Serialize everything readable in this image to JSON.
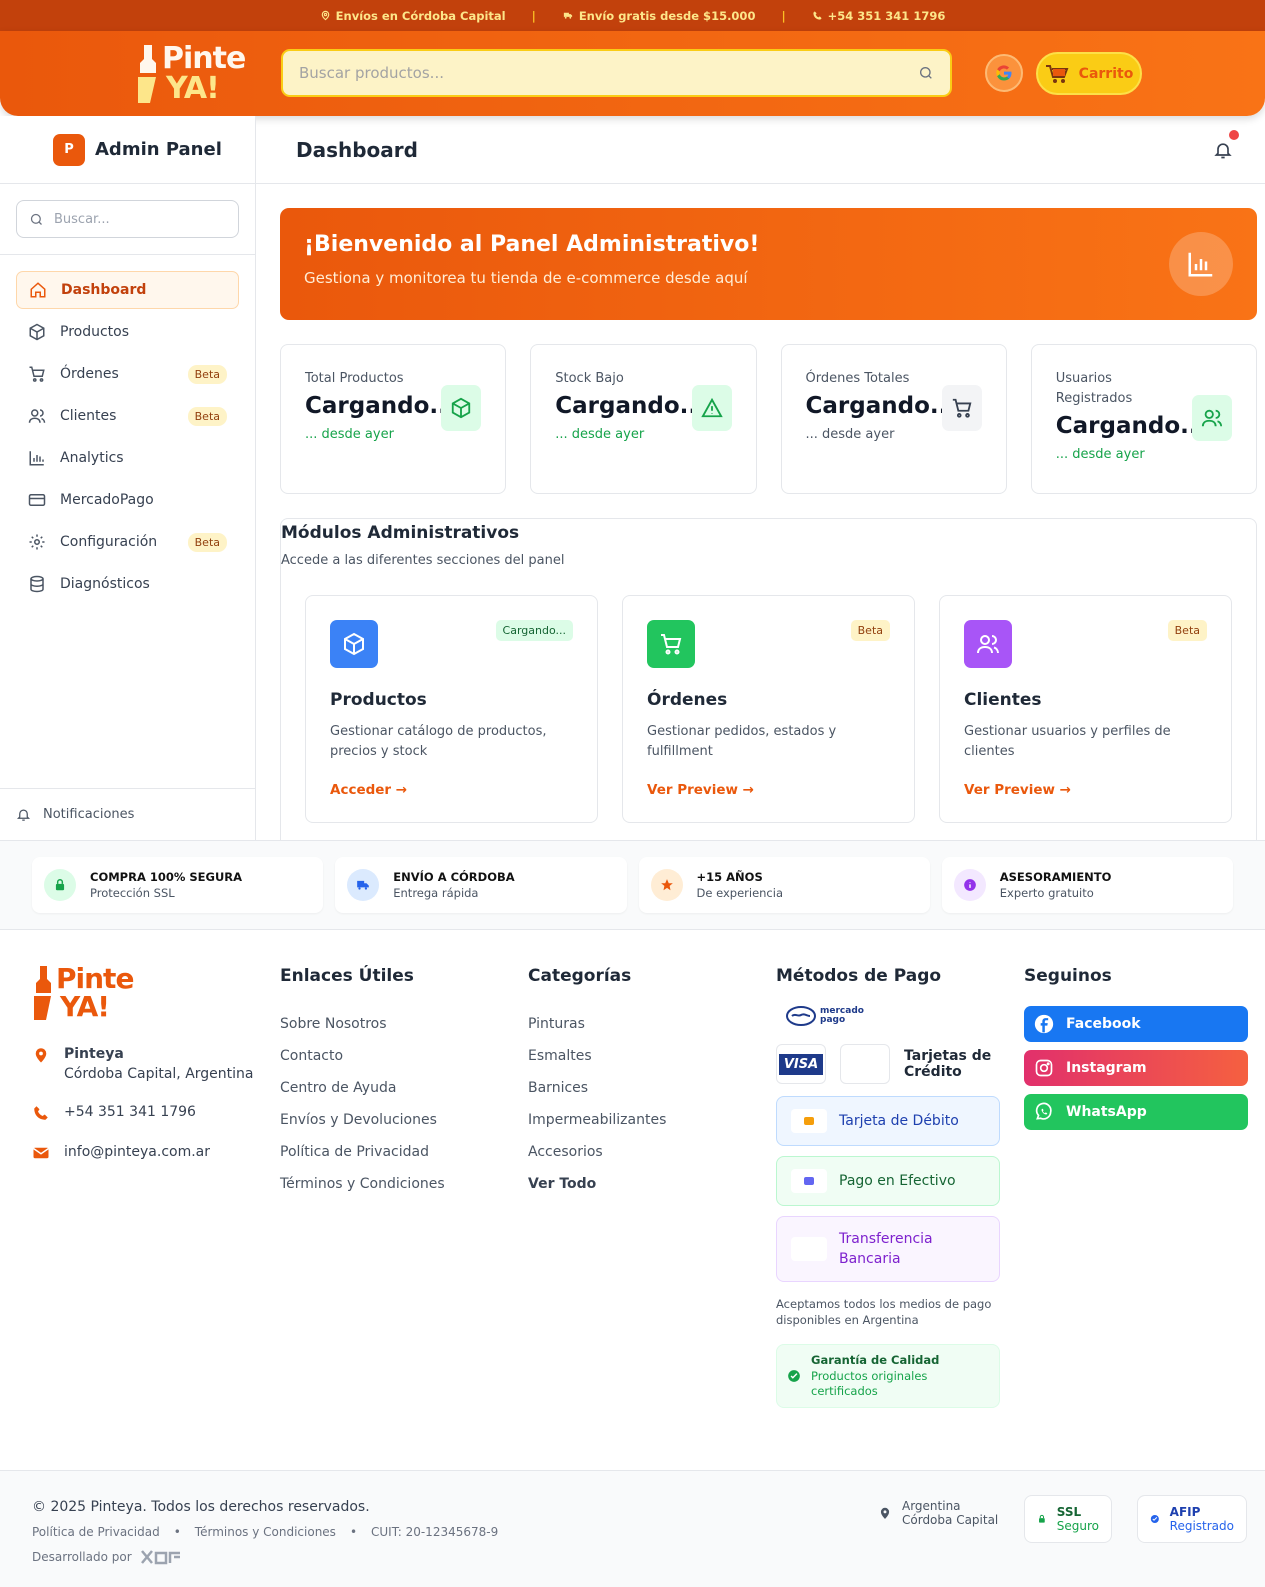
{
  "topbar": {
    "location": "Envíos en Córdoba Capital",
    "shipping": "Envío gratis desde $15.000",
    "phone": "+54 351 341 1796"
  },
  "header": {
    "search_placeholder": "Buscar productos...",
    "cart_label": "Carrito"
  },
  "sidebar": {
    "title": "Admin Panel",
    "logo_letter": "P",
    "search_placeholder": "Buscar...",
    "items": [
      {
        "label": "Dashboard",
        "icon": "home-icon"
      },
      {
        "label": "Productos",
        "icon": "box-icon"
      },
      {
        "label": "Órdenes",
        "icon": "cart-icon",
        "badge": "Beta"
      },
      {
        "label": "Clientes",
        "icon": "users-icon",
        "badge": "Beta"
      },
      {
        "label": "Analytics",
        "icon": "bar-chart-icon"
      },
      {
        "label": "MercadoPago",
        "icon": "credit-card-icon"
      },
      {
        "label": "Configuración",
        "icon": "gear-icon",
        "badge": "Beta"
      },
      {
        "label": "Diagnósticos",
        "icon": "database-icon"
      }
    ],
    "footer": "Notificaciones"
  },
  "main": {
    "title": "Dashboard",
    "welcome_title": "¡Bienvenido al Panel Administrativo!",
    "welcome_text": "Gestiona y monitorea tu tienda de e-commerce desde aquí",
    "stats": [
      {
        "label": "Total Productos",
        "value": "Cargando...",
        "sub": "... desde ayer"
      },
      {
        "label": "Stock Bajo",
        "value": "Cargando...",
        "sub": "... desde ayer"
      },
      {
        "label": "Órdenes Totales",
        "value": "Cargando...",
        "sub": "... desde ayer"
      },
      {
        "label": "Usuarios Registrados",
        "value": "Cargando...",
        "sub": "... desde ayer"
      }
    ],
    "modules_title": "Módulos Administrativos",
    "modules_desc": "Accede a las diferentes secciones del panel",
    "modules": [
      {
        "title": "Productos",
        "badge": "Cargando...",
        "desc": "Gestionar catálogo de productos, precios y stock",
        "link": "Acceder →"
      },
      {
        "title": "Órdenes",
        "badge": "Beta",
        "desc": "Gestionar pedidos, estados y fulfillment",
        "link": "Ver Preview →"
      },
      {
        "title": "Clientes",
        "badge": "Beta",
        "desc": "Gestionar usuarios y perfiles de clientes",
        "link": "Ver Preview →"
      }
    ]
  },
  "trust": [
    {
      "title": "COMPRA 100% SEGURA",
      "sub": "Protección SSL"
    },
    {
      "title": "ENVÍO A CÓRDOBA",
      "sub": "Entrega rápida"
    },
    {
      "title": "+15 AÑOS",
      "sub": "De experiencia"
    },
    {
      "title": "ASESORAMIENTO",
      "sub": "Experto gratuito"
    }
  ],
  "footer": {
    "company": "Pinteya",
    "address": "Córdoba Capital, Argentina",
    "phone": "+54 351 341 1796",
    "email": "info@pinteya.com.ar",
    "links_title": "Enlaces Útiles",
    "links": [
      "Sobre Nosotros",
      "Contacto",
      "Centro de Ayuda",
      "Envíos y Devoluciones",
      "Política de Privacidad",
      "Términos y Condiciones"
    ],
    "categories_title": "Categorías",
    "categories": [
      "Pinturas",
      "Esmaltes",
      "Barnices",
      "Impermeabilizantes",
      "Accesorios",
      "Ver Todo"
    ],
    "payments_title": "Métodos de Pago",
    "mp_logo": "mercado pago",
    "visa": "VISA",
    "credit": "Tarjetas de Crédito",
    "debit": "Tarjeta de Débito",
    "cash": "Pago en Efectivo",
    "transfer": "Transferencia Bancaria",
    "payments_note": "Aceptamos todos los medios de pago disponibles en Argentina",
    "quality_title": "Garantía de Calidad",
    "quality_sub": "Productos originales certificados",
    "social_title": "Seguinos",
    "social": [
      "Facebook",
      "Instagram",
      "WhatsApp"
    ]
  },
  "bottom": {
    "copyright": "© 2025 Pinteya. Todos los derechos reservados.",
    "privacy": "Política de Privacidad",
    "terms": "Términos y Condiciones",
    "cuit": "CUIT: 20-12345678-9",
    "dev": "Desarrollado por",
    "country": "Argentina",
    "city": "Córdoba Capital",
    "ssl_title": "SSL",
    "ssl_sub": "Seguro",
    "afip_title": "AFIP",
    "afip_sub": "Registrado"
  },
  "logo": {
    "line1": "Pinte",
    "line2": "YA!"
  },
  "colors": {
    "brand": "#ea580c",
    "accent": "#facc15",
    "success": "#16a34a"
  }
}
